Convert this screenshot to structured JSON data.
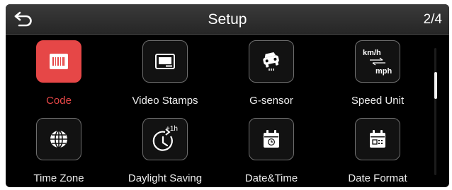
{
  "header": {
    "title": "Setup",
    "page_indicator": "2/4",
    "back_icon": "back-arrow-icon"
  },
  "menu": {
    "items": [
      {
        "label": "Code",
        "icon": "code-icon",
        "selected": true
      },
      {
        "label": "Video Stamps",
        "icon": "video-stamp-icon",
        "selected": false
      },
      {
        "label": "G-sensor",
        "icon": "car-sensor-icon",
        "selected": false
      },
      {
        "label": "Speed Unit",
        "icon": "speed-unit-icon",
        "icon_text_top": "km/h",
        "icon_text_bottom": "mph",
        "selected": false
      },
      {
        "label": "Time Zone",
        "icon": "globe-icon",
        "selected": false
      },
      {
        "label": "Daylight Saving",
        "icon": "clock-plus-hour-icon",
        "icon_text": "+1h",
        "selected": false
      },
      {
        "label": "Date&Time",
        "icon": "calendar-clock-icon",
        "selected": false
      },
      {
        "label": "Date Format",
        "icon": "calendar-format-icon",
        "selected": false
      }
    ]
  },
  "colors": {
    "accent": "#e64747",
    "background": "#000000",
    "header": "#2e2e2e",
    "text": "#ededed"
  }
}
